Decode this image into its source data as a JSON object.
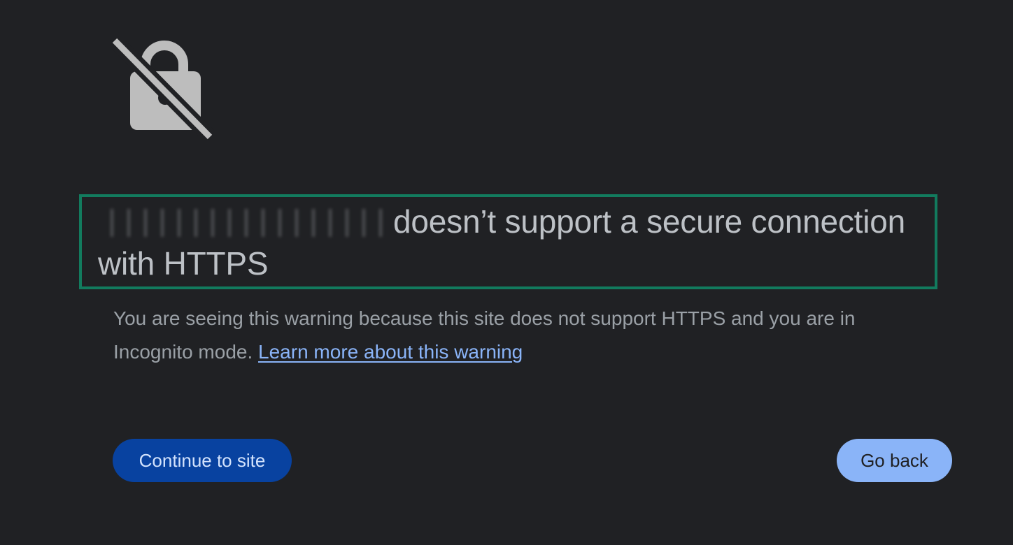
{
  "icon": {
    "name": "lock-slash-icon",
    "color": "#bdbdbd"
  },
  "warning": {
    "headline_suffix": "doesn’t support a secure connection with HTTPS",
    "body_text": "You are seeing this warning because this site does not support HTTPS and you are in Incognito mode. ",
    "learn_more_link": "Learn more about this warning"
  },
  "actions": {
    "continue_label": "Continue to site",
    "go_back_label": "Go back"
  },
  "colors": {
    "background": "#202124",
    "headline": "#bdc1c6",
    "body": "#9aa0a6",
    "link": "#8ab4f8",
    "primary_button": "#0842a0",
    "secondary_button": "#8ab4f8",
    "highlight_border": "#127b5e"
  }
}
